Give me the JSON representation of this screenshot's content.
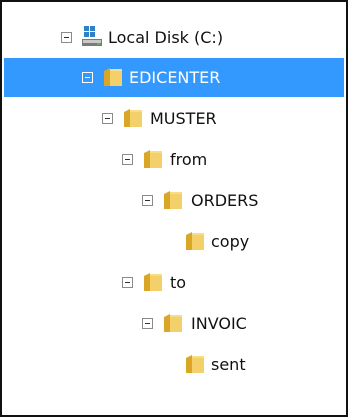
{
  "colors": {
    "selection": "#3399ff",
    "border": "#111111",
    "folder_light": "#f4d06a",
    "folder_dark": "#d9a628",
    "drive_blue": "#2f7fc9"
  },
  "tree": {
    "drive": {
      "label": "Local Disk (C:)",
      "icon": "drive-icon"
    },
    "items": [
      {
        "label": "EDICENTER",
        "icon": "folder-icon",
        "selected": true
      },
      {
        "label": "MUSTER",
        "icon": "folder-icon"
      },
      {
        "label": "from",
        "icon": "folder-icon"
      },
      {
        "label": "ORDERS",
        "icon": "folder-icon"
      },
      {
        "label": "copy",
        "icon": "folder-icon"
      },
      {
        "label": "to",
        "icon": "folder-icon"
      },
      {
        "label": "INVOIC",
        "icon": "folder-icon"
      },
      {
        "label": "sent",
        "icon": "folder-icon"
      }
    ]
  }
}
